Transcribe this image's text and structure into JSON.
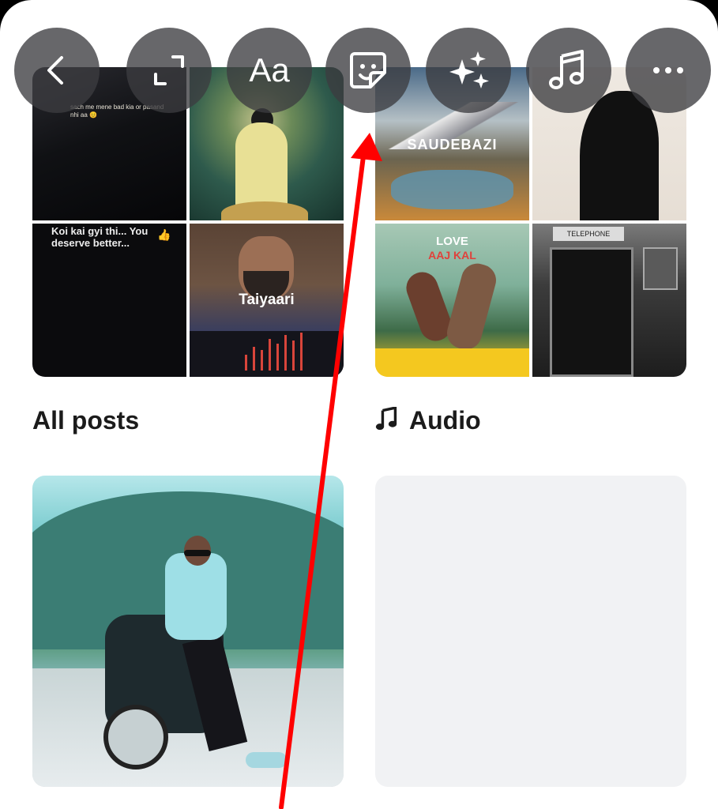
{
  "toolbar": {
    "buttons": [
      {
        "id": "back",
        "icon": "chevron-left-icon"
      },
      {
        "id": "resize",
        "icon": "crop-resize-icon"
      },
      {
        "id": "text",
        "icon": "text-icon",
        "label": "Aa"
      },
      {
        "id": "sticker",
        "icon": "sticker-icon"
      },
      {
        "id": "effects",
        "icon": "sparkles-icon"
      },
      {
        "id": "music",
        "icon": "music-note-icon"
      },
      {
        "id": "more",
        "icon": "more-horizontal-icon"
      }
    ]
  },
  "collections": {
    "all_posts": {
      "title": "All posts",
      "cover_texts": {
        "tile1": "sach me mene bad kia or pasand nhi aa 😊",
        "tile3": "Koi kai gyi thi... You deserve better...",
        "tile4": "Taiyaari"
      }
    },
    "audio": {
      "title": "Audio",
      "icon": "music-note-icon",
      "cover_texts": {
        "tile1": "SAUDEBAZI",
        "tile3_line1": "LOVE",
        "tile3_line2": "AAJ KAL",
        "tile4": "TELEPHONE"
      }
    }
  },
  "annotation": {
    "color": "#ff0000",
    "type": "arrow",
    "points_to": "sticker-button"
  },
  "colors": {
    "button_bg": "rgba(60,60,64,0.78)",
    "text": "#1b1b1b",
    "placeholder": "#f1f2f4"
  }
}
